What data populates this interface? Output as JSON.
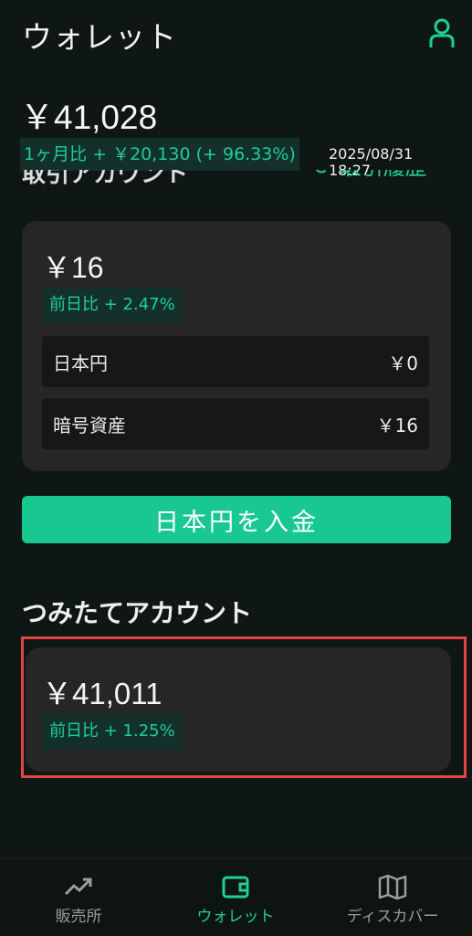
{
  "header": {
    "title": "ウォレット",
    "profile_icon": "person-icon"
  },
  "summary": {
    "total": "￥41,028",
    "monthly_change": "1ヶ月比 + ￥20,130 (+ 96.33%)",
    "timestamp_line1": "2025/08/31",
    "timestamp_line2": "18:27"
  },
  "trading": {
    "section_title": "取引アカウント",
    "history_link": "取引履歴",
    "amount": "￥16",
    "daily_change": "前日比 + 2.47%",
    "rows": [
      {
        "label": "日本円",
        "value": "￥0"
      },
      {
        "label": "暗号資産",
        "value": "￥16"
      }
    ],
    "deposit_button": "日本円を入金"
  },
  "savings": {
    "section_title": "つみたてアカウント",
    "amount": "￥41,011",
    "daily_change": "前日比 + 1.25%"
  },
  "bottom_nav": {
    "items": [
      {
        "label": "販売所",
        "icon": "trend-chart-icon"
      },
      {
        "label": "ウォレット",
        "icon": "wallet-icon"
      },
      {
        "label": "ディスカバー",
        "icon": "map-icon"
      }
    ],
    "active": "ウォレット"
  },
  "colors": {
    "background": "#0f1714",
    "accent": "#1fcf95",
    "button": "#18c890",
    "card": "#252625",
    "highlight_border": "#e04646"
  }
}
